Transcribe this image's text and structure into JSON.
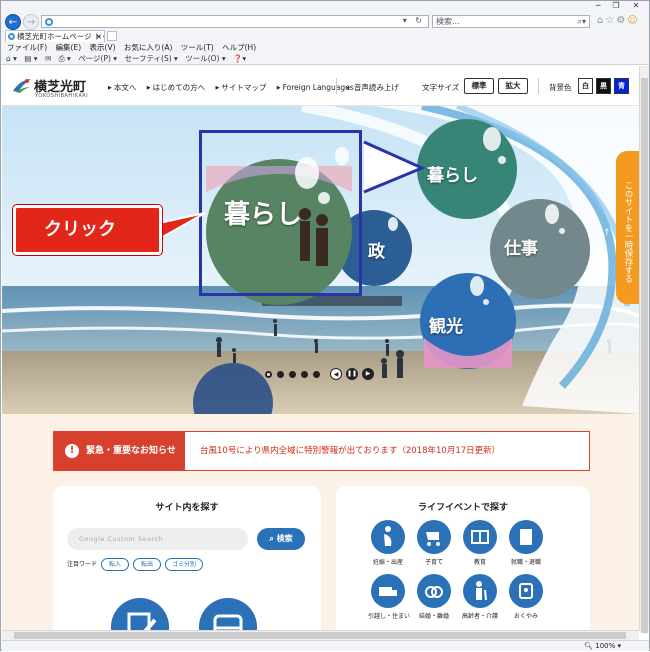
{
  "browser": {
    "address_url": "",
    "search_placeholder": "検索...",
    "tab_title": "横芝光町ホームページ トップペ...",
    "menu": [
      "ファイル(F)",
      "編集(E)",
      "表示(V)",
      "お気に入り(A)",
      "ツール(T)",
      "ヘルプ(H)"
    ],
    "commands": [
      "ページ(P) ▾",
      "セーフティ(S) ▾",
      "ツール(O) ▾"
    ],
    "zoom": "100%"
  },
  "site": {
    "logo_text": "横芝光町",
    "logo_sub": "YOKOSHIBAHIKARI",
    "nav": [
      "本文へ",
      "はじめての方へ",
      "サイトマップ",
      "Foreign Languages"
    ],
    "read_aloud": "音声読み上げ",
    "font_size_label": "文字サイズ",
    "font_standard": "標準",
    "font_large": "拡大",
    "bg_color_label": "背景色",
    "bg_white": "白",
    "bg_black": "黒",
    "bg_blue": "青",
    "colors": {
      "brand_blue": "#2a71b8",
      "alert_red": "#d6402c",
      "save_orange": "#f39a1f",
      "callout_border": "#2a33a8"
    }
  },
  "hero": {
    "bubbles": {
      "kurashi_big": "暮らし",
      "kurashi": "暮らし",
      "gyosei": "政",
      "shigoto": "仕事",
      "kanko": "観光"
    },
    "save_tab": "このサイトを一時保存する",
    "callout_label": "クリック",
    "pager": {
      "dots": 5,
      "active_index": 0
    }
  },
  "alert": {
    "heading": "緊急・重要なお知らせ",
    "text": "台風10号により県内全域に特別警報が出ております（2018年10月17日更新）"
  },
  "site_search": {
    "title": "サイト内を探す",
    "placeholder": "Google Custom Search",
    "button": "検索",
    "keywords_label": "注目ワード",
    "keywords": [
      "転入",
      "転出",
      "ゴミ分別"
    ]
  },
  "life_events": {
    "title": "ライフイベントで探す",
    "items": [
      "妊娠・出産",
      "子育て",
      "教育",
      "就職・退職",
      "引越し・住まい",
      "結婚・離婚",
      "高齢者・介護",
      "おくやみ"
    ]
  }
}
